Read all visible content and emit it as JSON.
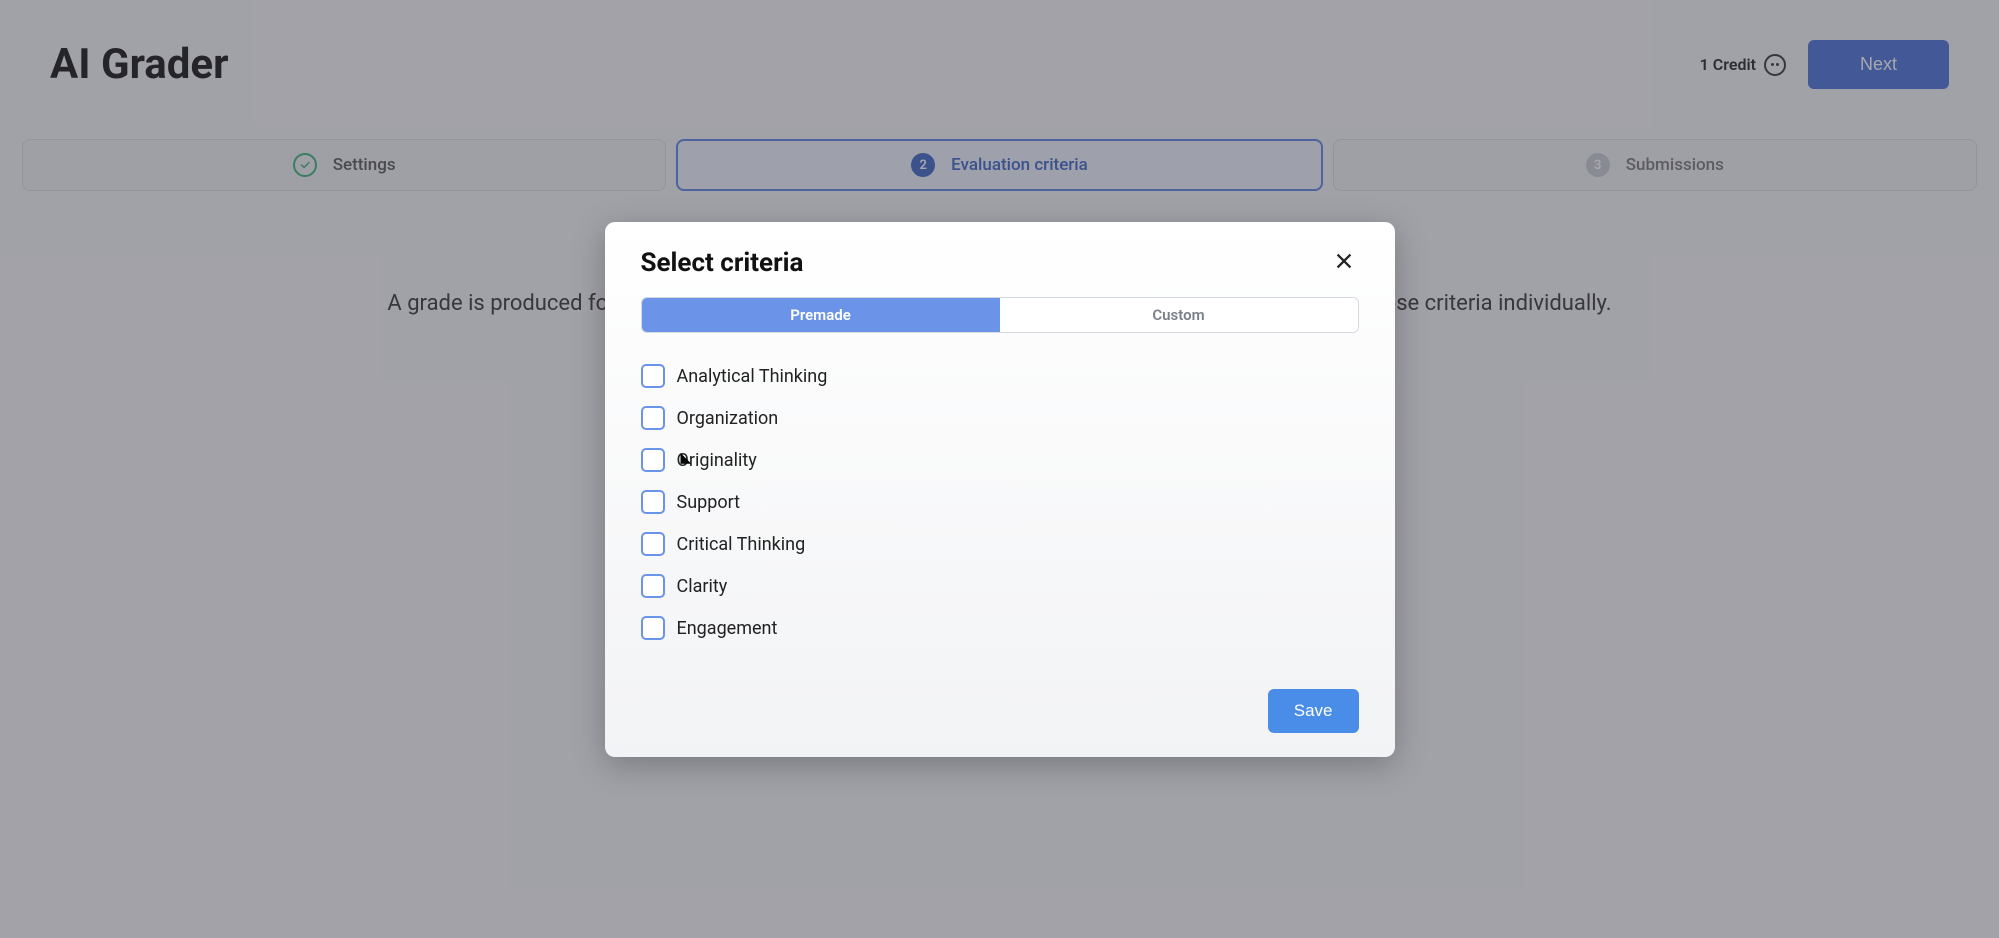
{
  "header": {
    "page_title": "AI Grader",
    "credit_text": "1 Credit",
    "next_button": "Next"
  },
  "stepper": {
    "steps": [
      {
        "label": "Settings",
        "state": "completed"
      },
      {
        "number": "2",
        "label": "Evaluation criteria",
        "state": "active"
      },
      {
        "number": "3",
        "label": "Submissions",
        "state": "pending"
      }
    ]
  },
  "background_description": "A grade is produced for each evaluation criteria you select. You can start from a premade rubric or choose criteria individually.",
  "modal": {
    "title": "Select criteria",
    "tabs": {
      "premade": "Premade",
      "custom": "Custom",
      "active": "premade"
    },
    "criteria": [
      {
        "label": "Analytical Thinking",
        "checked": false
      },
      {
        "label": "Organization",
        "checked": false
      },
      {
        "label": "Originality",
        "checked": false
      },
      {
        "label": "Support",
        "checked": false
      },
      {
        "label": "Critical Thinking",
        "checked": false
      },
      {
        "label": "Clarity",
        "checked": false
      },
      {
        "label": "Engagement",
        "checked": false
      }
    ],
    "save_button": "Save"
  }
}
